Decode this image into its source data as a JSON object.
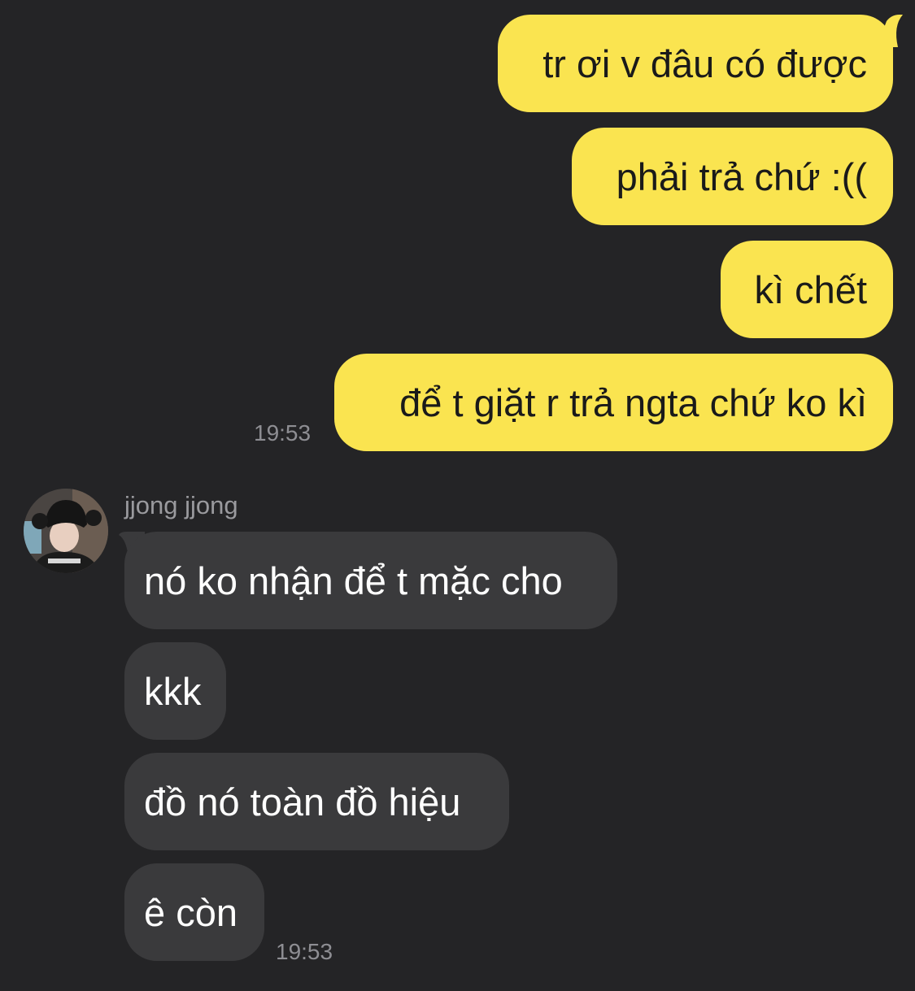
{
  "outgoing": {
    "messages": [
      "tr ơi v đâu có được",
      "phải trả chứ :((",
      "kì chết",
      "để t giặt r trả ngta chứ ko kì"
    ],
    "time": "19:53"
  },
  "incoming": {
    "sender": "jjong jjong",
    "messages": [
      "nó ko nhận để t mặc cho",
      "kkk",
      "đồ nó toàn đồ hiệu",
      "ê còn"
    ],
    "time": "19:53"
  },
  "colors": {
    "background": "#242426",
    "outgoing_bubble": "#FAE450",
    "incoming_bubble": "#3a3a3c"
  }
}
